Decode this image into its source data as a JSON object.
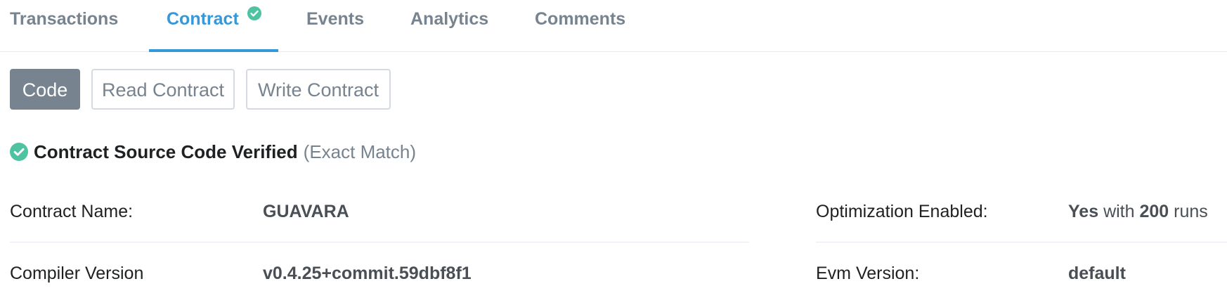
{
  "tabs": [
    {
      "label": "Transactions"
    },
    {
      "label": "Contract",
      "verified_check": true
    },
    {
      "label": "Events"
    },
    {
      "label": "Analytics"
    },
    {
      "label": "Comments"
    }
  ],
  "active_tab": "Contract",
  "sub_buttons": [
    {
      "label": "Code"
    },
    {
      "label": "Read Contract"
    },
    {
      "label": "Write Contract"
    }
  ],
  "active_sub_button": "Code",
  "verification": {
    "title": "Contract Source Code Verified",
    "note": "(Exact Match)",
    "icon": "check-circle-icon"
  },
  "info": {
    "contract_name_label": "Contract Name:",
    "contract_name_value": "GUAVARA",
    "compiler_version_label": "Compiler Version",
    "compiler_version_value": "v0.4.25+commit.59dbf8f1",
    "optimization_label": "Optimization Enabled:",
    "optimization_yes": "Yes",
    "optimization_with": "with",
    "optimization_runs": "200",
    "optimization_runs_suffix": "runs",
    "evm_version_label": "Evm Version:",
    "evm_version_value": "default"
  },
  "colors": {
    "accent": "#3498db",
    "verified_green": "#4fc3a1",
    "muted": "#77838f",
    "border": "#d5dae2"
  }
}
